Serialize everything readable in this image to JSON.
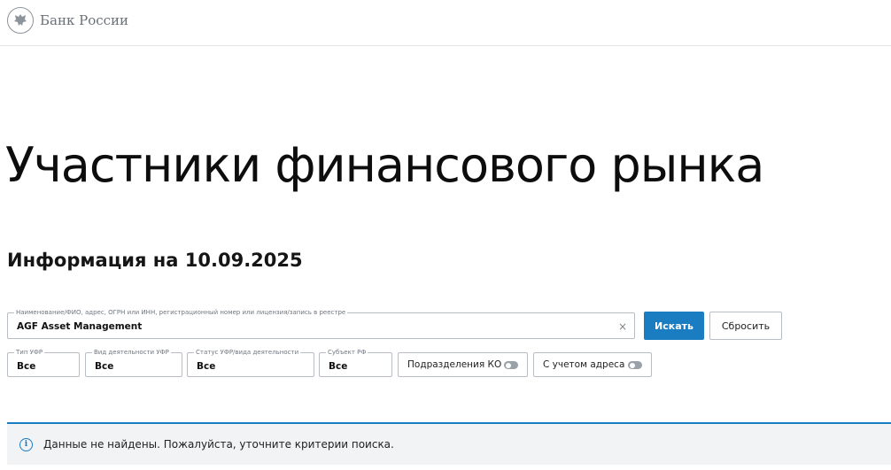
{
  "brand": {
    "name": "Банк России",
    "logo_icon": "eagle-emblem-icon"
  },
  "page": {
    "title": "Участники финансового рынка",
    "subtitle": "Информация на 10.09.2025"
  },
  "search": {
    "legend": "Наименование/ФИО, адрес, ОГРН или ИНН, регистрационный номер или лицензия/запись в реестре",
    "value": "AGF Asset Management",
    "clear_icon": "close-icon",
    "search_button": "Искать",
    "reset_button": "Сбросить"
  },
  "filters": [
    {
      "legend": "Тип УФР",
      "value": "Все"
    },
    {
      "legend": "Вид деятельности УФР",
      "value": "Все"
    },
    {
      "legend": "Статус УФР/вида деятельности",
      "value": "Все"
    },
    {
      "legend": "Субъект РФ",
      "value": "Все"
    }
  ],
  "toggles": [
    {
      "label": "Подразделения КО",
      "on": false
    },
    {
      "label": "С учетом адреса",
      "on": false
    }
  ],
  "notice": {
    "icon": "info-icon",
    "text": "Данные не найдены. Пожалуйста, уточните критерии поиска."
  },
  "colors": {
    "accent": "#1a7cc1",
    "border": "#b9bec5",
    "notice_bg": "#f2f3f5"
  }
}
